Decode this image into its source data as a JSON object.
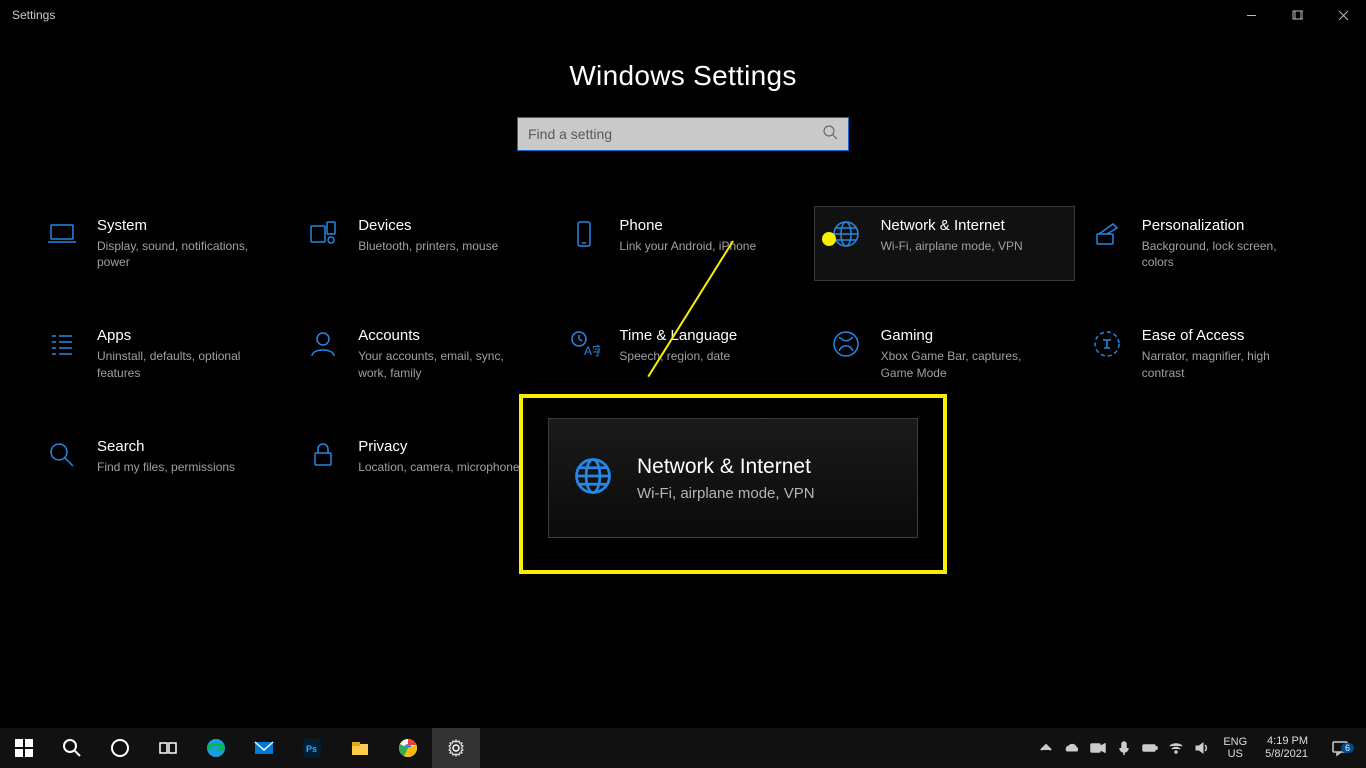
{
  "titlebar": {
    "app": "Settings"
  },
  "header": {
    "title": "Windows Settings"
  },
  "search": {
    "placeholder": "Find a setting"
  },
  "tiles": [
    {
      "key": "system",
      "title": "System",
      "sub": "Display, sound, notifications, power"
    },
    {
      "key": "devices",
      "title": "Devices",
      "sub": "Bluetooth, printers, mouse"
    },
    {
      "key": "phone",
      "title": "Phone",
      "sub": "Link your Android, iPhone"
    },
    {
      "key": "network",
      "title": "Network & Internet",
      "sub": "Wi-Fi, airplane mode, VPN"
    },
    {
      "key": "personalization",
      "title": "Personalization",
      "sub": "Background, lock screen, colors"
    },
    {
      "key": "apps",
      "title": "Apps",
      "sub": "Uninstall, defaults, optional features"
    },
    {
      "key": "accounts",
      "title": "Accounts",
      "sub": "Your accounts, email, sync, work, family"
    },
    {
      "key": "time",
      "title": "Time & Language",
      "sub": "Speech, region, date"
    },
    {
      "key": "gaming",
      "title": "Gaming",
      "sub": "Xbox Game Bar, captures, Game Mode"
    },
    {
      "key": "ease",
      "title": "Ease of Access",
      "sub": "Narrator, magnifier, high contrast"
    },
    {
      "key": "search",
      "title": "Search",
      "sub": "Find my files, permissions"
    },
    {
      "key": "privacy",
      "title": "Privacy",
      "sub": "Location, camera, microphone"
    }
  ],
  "callout": {
    "title": "Network & Internet",
    "sub": "Wi-Fi, airplane mode, VPN"
  },
  "taskbar": {
    "lang1": "ENG",
    "lang2": "US",
    "time": "4:19 PM",
    "date": "5/8/2021",
    "notif_count": "6"
  }
}
